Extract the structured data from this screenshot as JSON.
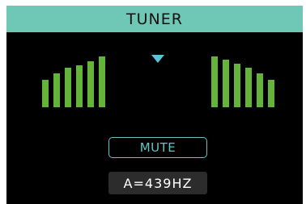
{
  "header": {
    "title": "TUNER"
  },
  "meter": {
    "bar_color": "#65b43a",
    "pointer_color": "#5cc2d8",
    "left_levels": [
      0.54,
      0.66,
      0.78,
      0.83,
      0.9,
      1.0
    ],
    "right_levels": [
      1.0,
      0.93,
      0.85,
      0.78,
      0.66,
      0.54
    ]
  },
  "controls": {
    "mute_label": "MUTE",
    "reference_pitch": "A=439HZ"
  },
  "colors": {
    "title_bar": "#6fc7b6",
    "background": "#000000",
    "mute_accent": "#63c4c3",
    "pitch_box": "#2c2c2c"
  }
}
